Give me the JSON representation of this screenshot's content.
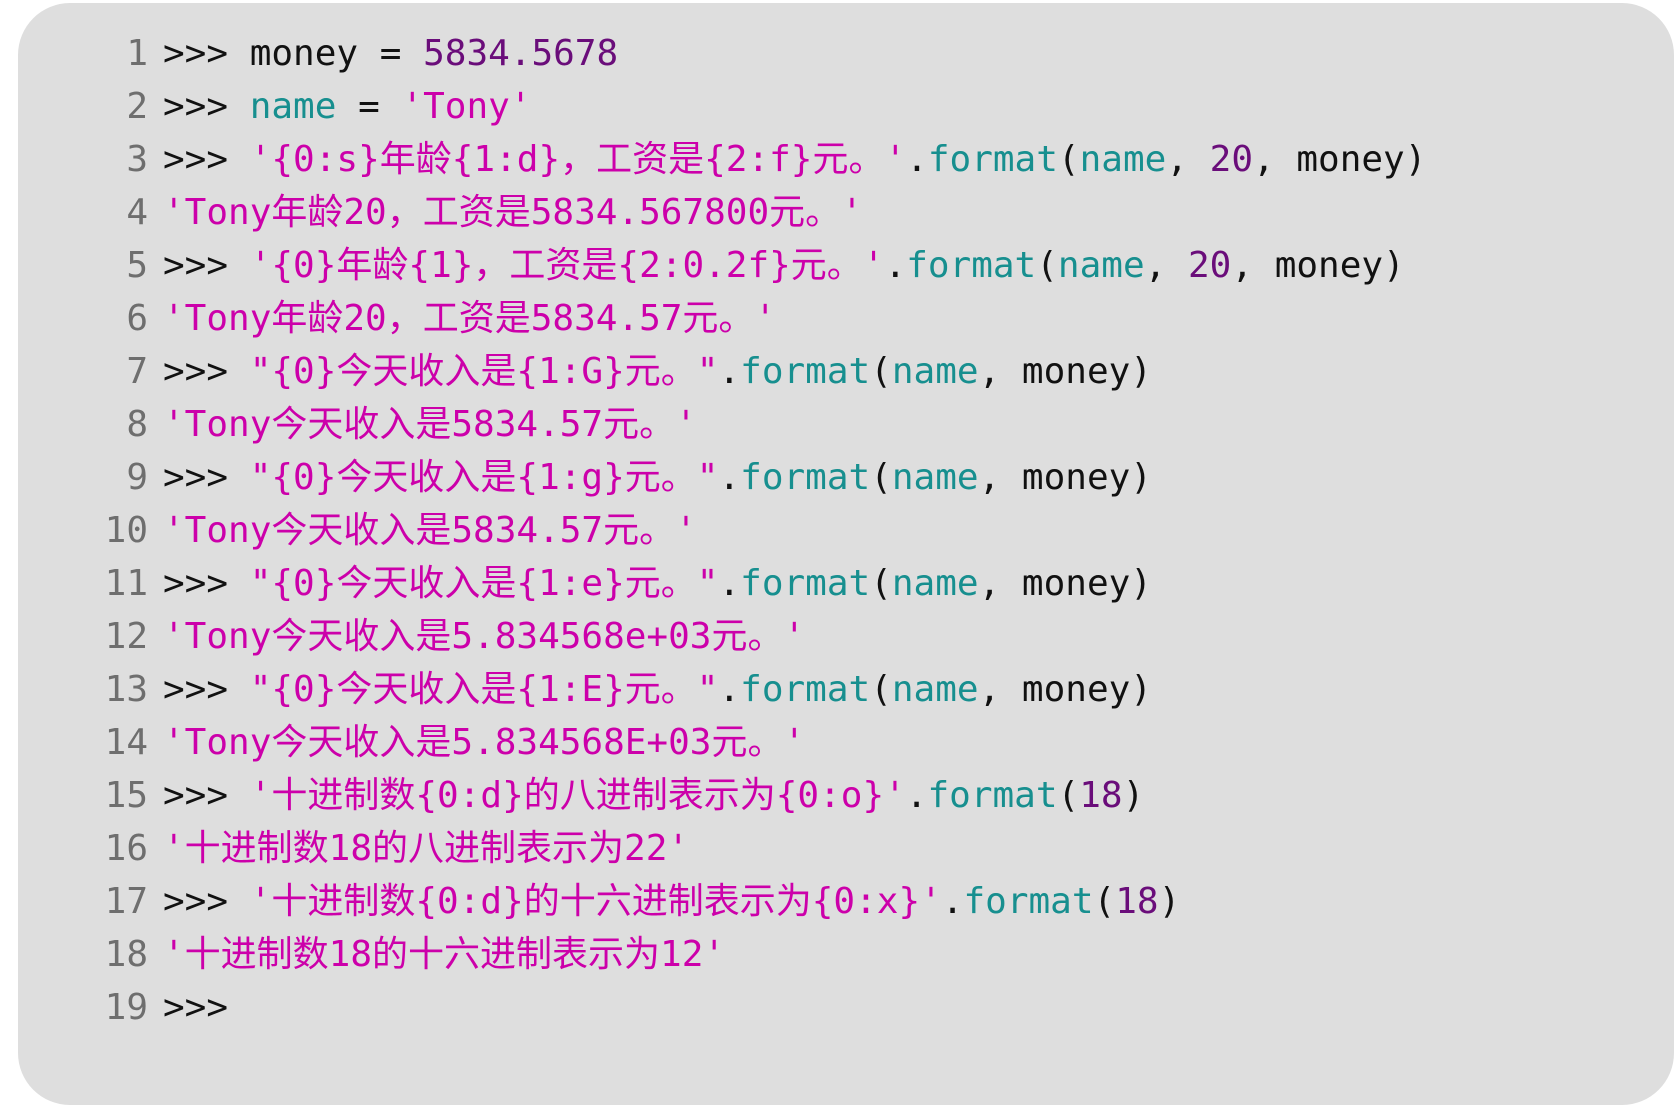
{
  "colors": {
    "panel_background": "#dedede",
    "line_number": "#6e6e6e",
    "prompt": "#111111",
    "plain": "#111111",
    "string": "#cc00aa",
    "number": "#6a0d7a",
    "name": "#178f8f"
  },
  "lines": [
    {
      "n": "1",
      "segs": [
        [
          "prompt",
          ">>> "
        ],
        [
          "plain",
          "money = "
        ],
        [
          "num",
          "5834.5678"
        ]
      ]
    },
    {
      "n": "2",
      "segs": [
        [
          "prompt",
          ">>> "
        ],
        [
          "name",
          "name"
        ],
        [
          "plain",
          " = "
        ],
        [
          "str",
          "'Tony'"
        ]
      ]
    },
    {
      "n": "3",
      "segs": [
        [
          "prompt",
          ">>> "
        ],
        [
          "str",
          "'{0:s}年龄{1:d}，工资是{2:f}元。'"
        ],
        [
          "plain",
          "."
        ],
        [
          "name",
          "format"
        ],
        [
          "plain",
          "("
        ],
        [
          "name",
          "name"
        ],
        [
          "plain",
          ", "
        ],
        [
          "num",
          "20"
        ],
        [
          "plain",
          ", money)"
        ]
      ]
    },
    {
      "n": "4",
      "segs": [
        [
          "str",
          "'Tony年龄20，工资是5834.567800元。'"
        ]
      ]
    },
    {
      "n": "5",
      "segs": [
        [
          "prompt",
          ">>> "
        ],
        [
          "str",
          "'{0}年龄{1}，工资是{2:0.2f}元。'"
        ],
        [
          "plain",
          "."
        ],
        [
          "name",
          "format"
        ],
        [
          "plain",
          "("
        ],
        [
          "name",
          "name"
        ],
        [
          "plain",
          ", "
        ],
        [
          "num",
          "20"
        ],
        [
          "plain",
          ", money)"
        ]
      ]
    },
    {
      "n": "6",
      "segs": [
        [
          "str",
          "'Tony年龄20，工资是5834.57元。'"
        ]
      ]
    },
    {
      "n": "7",
      "segs": [
        [
          "prompt",
          ">>> "
        ],
        [
          "str",
          "\"{0}今天收入是{1:G}元。\""
        ],
        [
          "plain",
          "."
        ],
        [
          "name",
          "format"
        ],
        [
          "plain",
          "("
        ],
        [
          "name",
          "name"
        ],
        [
          "plain",
          ", money)"
        ]
      ]
    },
    {
      "n": "8",
      "segs": [
        [
          "str",
          "'Tony今天收入是5834.57元。'"
        ]
      ]
    },
    {
      "n": "9",
      "segs": [
        [
          "prompt",
          ">>> "
        ],
        [
          "str",
          "\"{0}今天收入是{1:g}元。\""
        ],
        [
          "plain",
          "."
        ],
        [
          "name",
          "format"
        ],
        [
          "plain",
          "("
        ],
        [
          "name",
          "name"
        ],
        [
          "plain",
          ", money)"
        ]
      ]
    },
    {
      "n": "10",
      "segs": [
        [
          "str",
          "'Tony今天收入是5834.57元。'"
        ]
      ]
    },
    {
      "n": "11",
      "segs": [
        [
          "prompt",
          ">>> "
        ],
        [
          "str",
          "\"{0}今天收入是{1:e}元。\""
        ],
        [
          "plain",
          "."
        ],
        [
          "name",
          "format"
        ],
        [
          "plain",
          "("
        ],
        [
          "name",
          "name"
        ],
        [
          "plain",
          ", money)"
        ]
      ]
    },
    {
      "n": "12",
      "segs": [
        [
          "str",
          "'Tony今天收入是5.834568e+03元。'"
        ]
      ]
    },
    {
      "n": "13",
      "segs": [
        [
          "prompt",
          ">>> "
        ],
        [
          "str",
          "\"{0}今天收入是{1:E}元。\""
        ],
        [
          "plain",
          "."
        ],
        [
          "name",
          "format"
        ],
        [
          "plain",
          "("
        ],
        [
          "name",
          "name"
        ],
        [
          "plain",
          ", money)"
        ]
      ]
    },
    {
      "n": "14",
      "segs": [
        [
          "str",
          "'Tony今天收入是5.834568E+03元。'"
        ]
      ]
    },
    {
      "n": "15",
      "segs": [
        [
          "prompt",
          ">>> "
        ],
        [
          "str",
          "'十进制数{0:d}的八进制表示为{0:o}'"
        ],
        [
          "plain",
          "."
        ],
        [
          "name",
          "format"
        ],
        [
          "plain",
          "("
        ],
        [
          "num",
          "18"
        ],
        [
          "plain",
          ")"
        ]
      ]
    },
    {
      "n": "16",
      "segs": [
        [
          "str",
          "'十进制数18的八进制表示为22'"
        ]
      ]
    },
    {
      "n": "17",
      "segs": [
        [
          "prompt",
          ">>> "
        ],
        [
          "str",
          "'十进制数{0:d}的十六进制表示为{0:x}'"
        ],
        [
          "plain",
          "."
        ],
        [
          "name",
          "format"
        ],
        [
          "plain",
          "("
        ],
        [
          "num",
          "18"
        ],
        [
          "plain",
          ")"
        ]
      ]
    },
    {
      "n": "18",
      "segs": [
        [
          "str",
          "'十进制数18的十六进制表示为12'"
        ]
      ]
    },
    {
      "n": "19",
      "segs": [
        [
          "prompt",
          ">>>"
        ]
      ]
    }
  ]
}
